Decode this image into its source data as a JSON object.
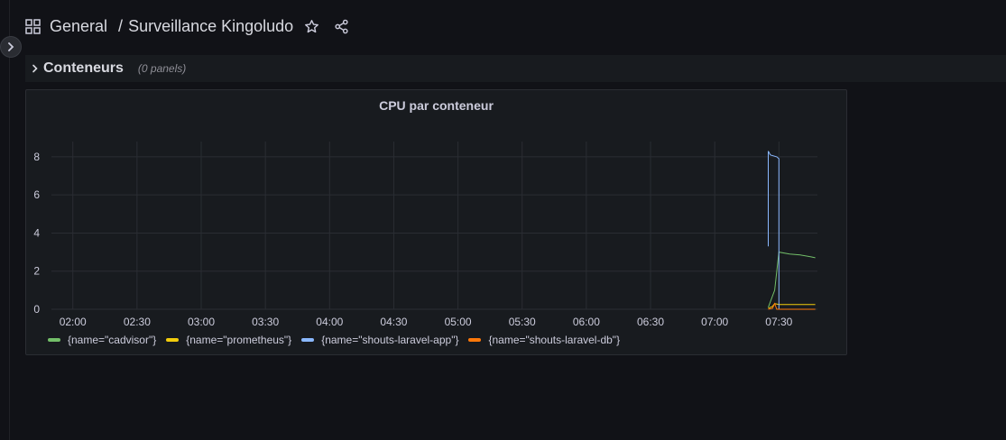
{
  "breadcrumb": {
    "folder": "General",
    "separator": "/",
    "dashboard": "Surveillance Kingoludo"
  },
  "row": {
    "title": "Conteneurs",
    "panel_count": "(0 panels)"
  },
  "panel": {
    "title": "CPU par conteneur"
  },
  "icons": {
    "dashboard": "grid-icon",
    "star": "star-icon",
    "share": "share-icon",
    "row_toggle": "chevron-right-icon",
    "sidebar_toggle": "chevron-right-icon"
  },
  "chart_data": {
    "type": "line",
    "title": "CPU par conteneur",
    "xlabel": "",
    "ylabel": "",
    "x_ticks": [
      "02:00",
      "02:30",
      "03:00",
      "03:30",
      "04:00",
      "04:30",
      "05:00",
      "05:30",
      "06:00",
      "06:30",
      "07:00",
      "07:30"
    ],
    "y_ticks": [
      "0",
      "2",
      "4",
      "6",
      "8"
    ],
    "xlim": [
      "01:50",
      "07:48"
    ],
    "ylim": [
      0,
      8.8
    ],
    "grid": true,
    "legend_position": "bottom-left",
    "series": [
      {
        "name": "{name=\"cadvisor\"}",
        "color": "#73bf69",
        "points": [
          [
            "07:25",
            0.1
          ],
          [
            "07:28",
            1.0
          ],
          [
            "07:30",
            3.0
          ],
          [
            "07:35",
            2.9
          ],
          [
            "07:40",
            2.85
          ],
          [
            "07:45",
            2.75
          ],
          [
            "07:47",
            2.7
          ]
        ]
      },
      {
        "name": "{name=\"prometheus\"}",
        "color": "#f2cc0c",
        "points": [
          [
            "07:25",
            0.05
          ],
          [
            "07:27",
            0.15
          ],
          [
            "07:28",
            0.3
          ],
          [
            "07:30",
            0.25
          ],
          [
            "07:35",
            0.25
          ],
          [
            "07:40",
            0.25
          ],
          [
            "07:47",
            0.25
          ]
        ]
      },
      {
        "name": "{name=\"shouts-laravel-app\"}",
        "color": "#8ab8ff",
        "points": [
          [
            "07:25",
            3.3
          ],
          [
            "07:25",
            8.3
          ],
          [
            "07:26",
            8.1
          ],
          [
            "07:29",
            8.0
          ],
          [
            "07:30",
            7.9
          ],
          [
            "07:30",
            0.0
          ],
          [
            "07:35",
            0.0
          ],
          [
            "07:47",
            0.0
          ]
        ]
      },
      {
        "name": "{name=\"shouts-laravel-db\"}",
        "color": "#ff780a",
        "points": [
          [
            "07:25",
            0.0
          ],
          [
            "07:27",
            0.05
          ],
          [
            "07:28",
            0.3
          ],
          [
            "07:29",
            0.0
          ],
          [
            "07:35",
            0.0
          ],
          [
            "07:47",
            0.0
          ]
        ]
      }
    ]
  }
}
